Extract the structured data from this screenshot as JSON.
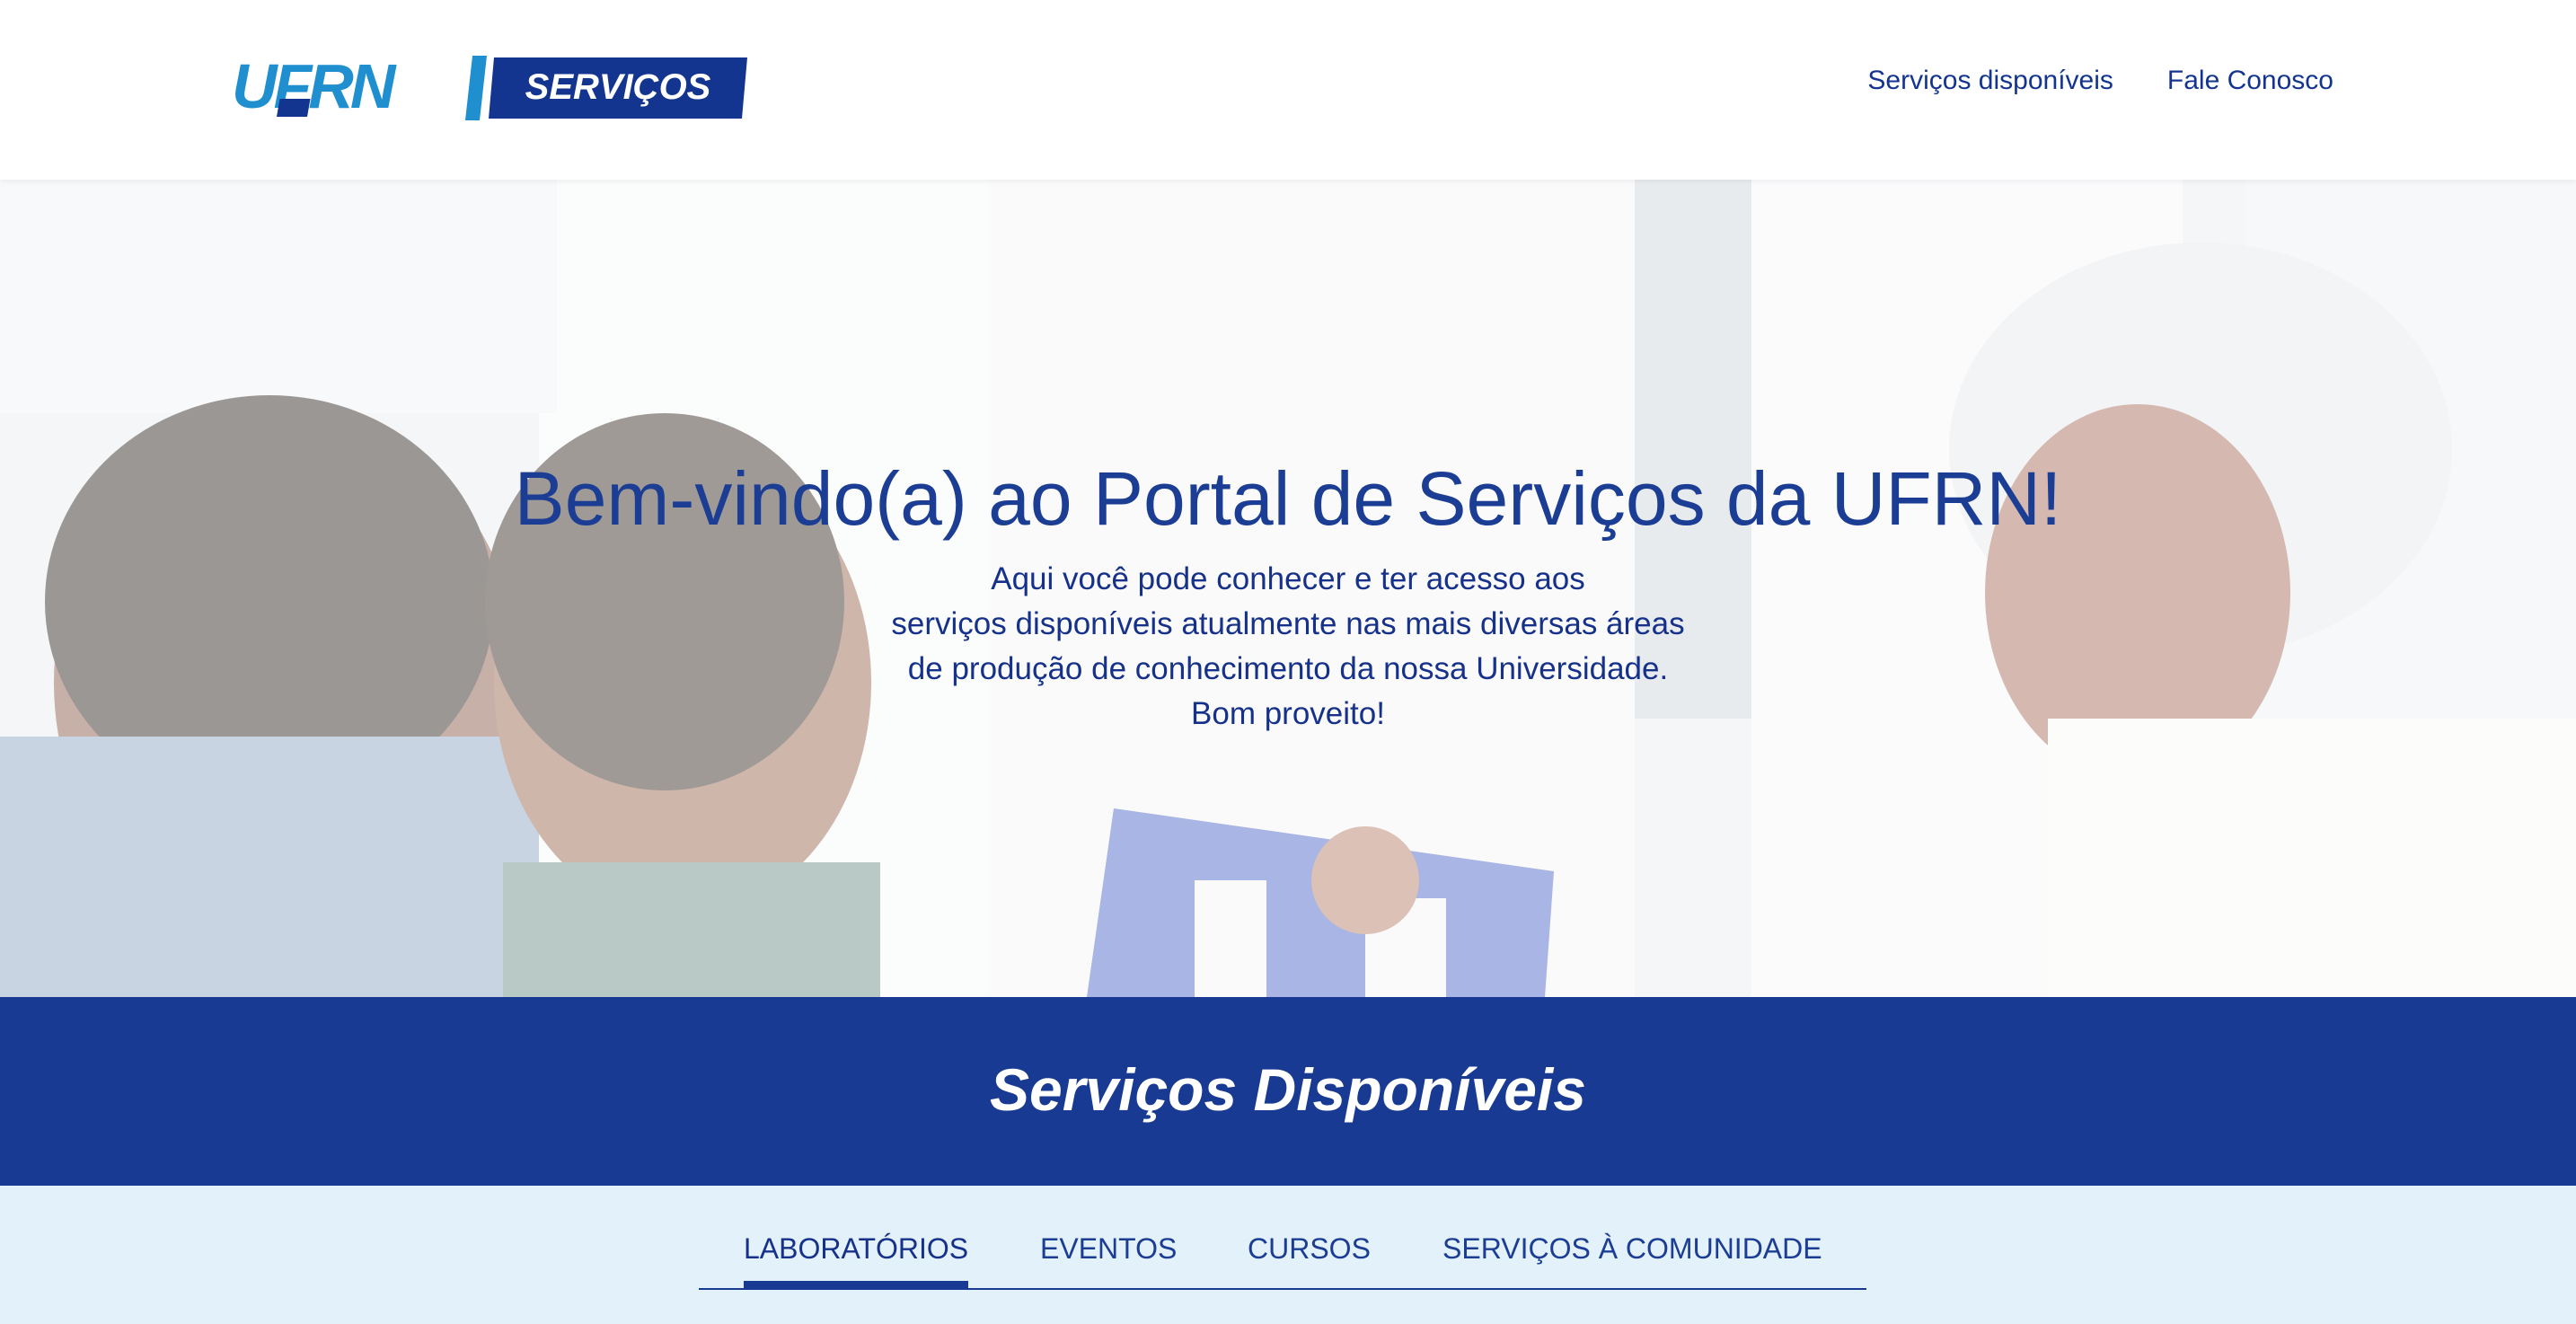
{
  "header": {
    "logo_text_left": "UFRN",
    "logo_text_right": "SERVIÇOS",
    "nav": [
      {
        "label": "Serviços disponíveis"
      },
      {
        "label": "Fale Conosco"
      }
    ]
  },
  "hero": {
    "title": "Bem-vindo(a) ao Portal de Serviços da UFRN!",
    "lines": [
      "Aqui você pode conhecer e ter acesso aos",
      "serviços disponíveis atualmente nas mais diversas áreas",
      "de produção de conhecimento da nossa Universidade.",
      "Bom proveito!"
    ]
  },
  "section": {
    "title": "Serviços Disponíveis"
  },
  "tabs": [
    {
      "label": "LABORATÓRIOS",
      "active": true
    },
    {
      "label": "EVENTOS",
      "active": false
    },
    {
      "label": "CURSOS",
      "active": false
    },
    {
      "label": "SERVIÇOS À COMUNIDADE",
      "active": false
    }
  ],
  "colors": {
    "brand_blue": "#183a93",
    "logo_light_blue": "#1f8fd0",
    "text_blue": "#13358f",
    "tabs_background": "#e3f1fa"
  }
}
